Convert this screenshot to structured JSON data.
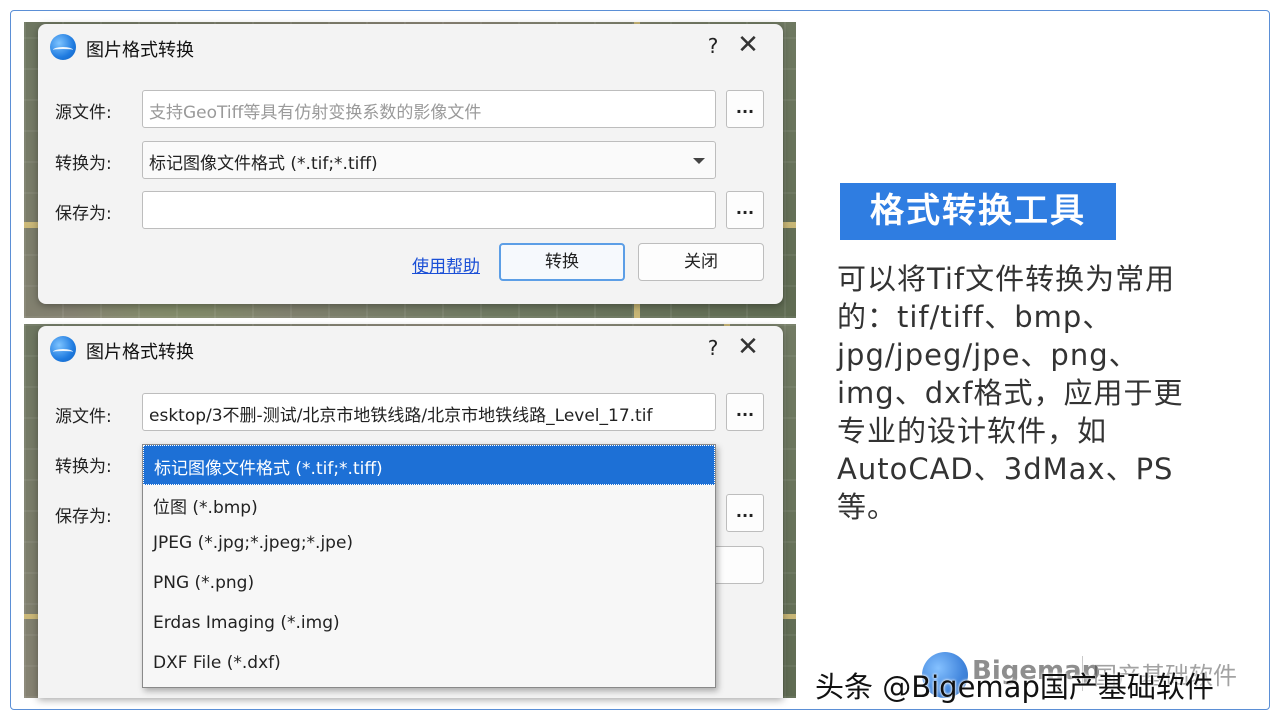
{
  "dialog_top": {
    "title": "图片格式转换",
    "help": "?",
    "close": "✕",
    "source_label": "源文件:",
    "source_placeholder": "支持GeoTiff等具有仿射变换系数的影像文件",
    "browse": "...",
    "convert_label": "转换为:",
    "convert_value": "标记图像文件格式 (*.tif;*.tiff)",
    "save_label": "保存为:",
    "save_value": "",
    "help_link": "使用帮助",
    "convert_button": "转换",
    "close_button": "关闭"
  },
  "dialog_bottom": {
    "title": "图片格式转换",
    "help": "?",
    "close": "✕",
    "source_label": "源文件:",
    "source_value": "esktop/3不删-测试/北京市地铁线路/北京市地铁线路_Level_17.tif",
    "browse": "...",
    "convert_label": "转换为:",
    "save_label": "保存为:",
    "options": [
      "标记图像文件格式 (*.tif;*.tiff)",
      "位图 (*.bmp)",
      "JPEG (*.jpg;*.jpeg;*.jpe)",
      "PNG (*.png)",
      "Erdas Imaging (*.img)",
      "DXF File (*.dxf)"
    ],
    "selected_option_index": 0
  },
  "side": {
    "heading": "格式转换工具",
    "description": "可以将Tif文件转换为常用的：tif/tiff、bmp、jpg/jpeg/jpe、png、img、dxf格式，应用于更专业的设计软件，如AutoCAD、3dMax、PS等。"
  },
  "footer": {
    "brand": "Bigemap",
    "tagline": "国产基础软件",
    "watermark": "头条 @Bigemap国产基础软件"
  },
  "colors": {
    "accent": "#2f7de1",
    "selection": "#1d70d6",
    "link": "#1a4fd6",
    "frame": "#5b8fd6"
  }
}
